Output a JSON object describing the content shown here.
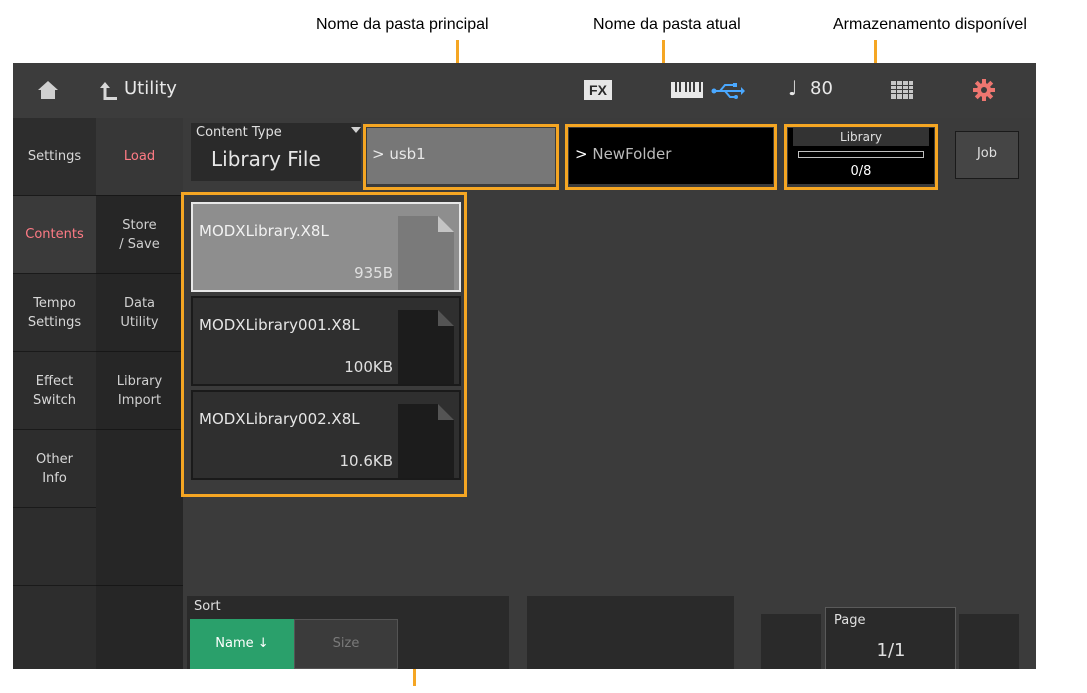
{
  "callouts": {
    "parent_folder": "Nome da pasta principal",
    "current_folder": "Nome da pasta atual",
    "storage": "Armazenamento disponível"
  },
  "topbar": {
    "title": "Utility",
    "fx": "FX",
    "tempo": "80"
  },
  "nav": [
    "Settings",
    "Contents",
    "Tempo\nSettings",
    "Effect\nSwitch",
    "Other\nInfo"
  ],
  "subnav": [
    "Load",
    "Store\n/ Save",
    "Data\nUtility",
    "Library\nImport"
  ],
  "content_type": {
    "label": "Content Type",
    "value": "Library File"
  },
  "parent_folder": "usb1",
  "current_folder": "NewFolder",
  "library": {
    "label": "Library",
    "count": "0/8",
    "fill": 0.0
  },
  "job_label": "Job",
  "files": [
    {
      "name": "MODXLibrary.X8L",
      "size": "935B"
    },
    {
      "name": "MODXLibrary001.X8L",
      "size": "100KB"
    },
    {
      "name": "MODXLibrary002.X8L",
      "size": "10.6KB"
    }
  ],
  "sort": {
    "label": "Sort",
    "name": "Name ↓",
    "size": "Size"
  },
  "page": {
    "label": "Page",
    "value": "1/1"
  },
  "colors": {
    "accent": "#f5a623",
    "active_nav": "#ff7b85",
    "sort_active": "#2aa06b"
  }
}
